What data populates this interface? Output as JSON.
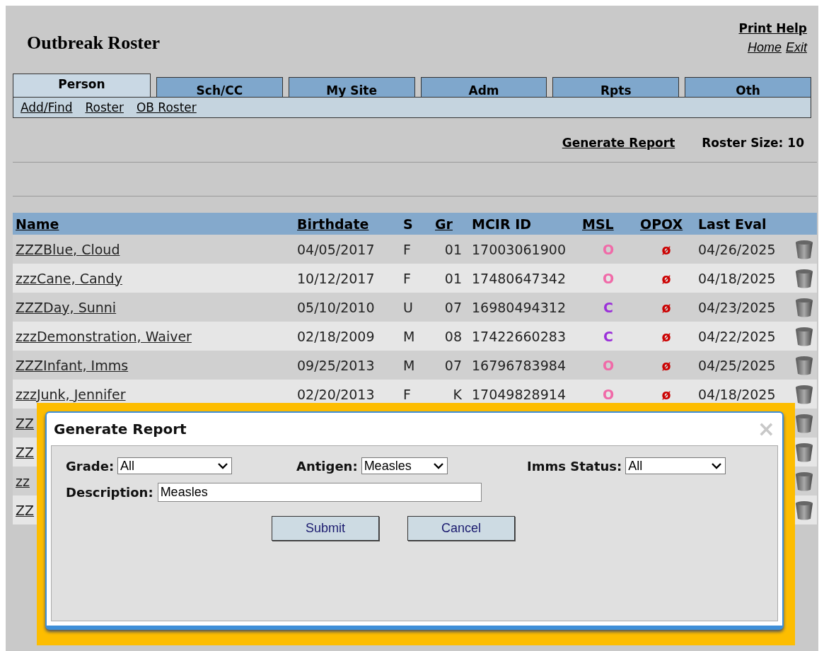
{
  "header": {
    "title": "Outbreak Roster",
    "links": [
      {
        "label": "Print Help",
        "kind": "bold"
      },
      {
        "label": "Home",
        "kind": "italic"
      },
      {
        "label": "Exit",
        "kind": "italic"
      }
    ]
  },
  "tabs": [
    {
      "label": "Person",
      "selected": true
    },
    {
      "label": "Sch/CC",
      "selected": false
    },
    {
      "label": "My Site",
      "selected": false
    },
    {
      "label": "Adm",
      "selected": false
    },
    {
      "label": "Rpts",
      "selected": false
    },
    {
      "label": "Oth",
      "selected": false
    }
  ],
  "subnav": [
    "Add/Find",
    "Roster",
    "OB Roster"
  ],
  "toolbar": {
    "link": "Generate Report",
    "roster_size": "Roster Size: 10"
  },
  "table": {
    "columns": [
      {
        "label": "Name",
        "sortable": true
      },
      {
        "label": "Birthdate",
        "sortable": true
      },
      {
        "label": "S",
        "sortable": false
      },
      {
        "label": "Gr",
        "sortable": true
      },
      {
        "label": "MCIR ID",
        "sortable": false
      },
      {
        "label": "MSL",
        "sortable": true
      },
      {
        "label": "OPOX",
        "sortable": true
      },
      {
        "label": "Last Eval",
        "sortable": false
      }
    ],
    "rows": [
      {
        "name": "ZZZBlue, Cloud",
        "birthdate": "04/05/2017",
        "s": "F",
        "gr": "01",
        "mcir_id": "17003061900",
        "msl": {
          "text": "O",
          "color": "#f06aa8"
        },
        "opox": {
          "text": "ø",
          "color": "#cc0000"
        },
        "last_eval": "04/26/2025"
      },
      {
        "name": "zzzCane, Candy",
        "birthdate": "10/12/2017",
        "s": "F",
        "gr": "01",
        "mcir_id": "17480647342",
        "msl": {
          "text": "O",
          "color": "#f06aa8"
        },
        "opox": {
          "text": "ø",
          "color": "#cc0000"
        },
        "last_eval": "04/18/2025"
      },
      {
        "name": "ZZZDay, Sunni",
        "birthdate": "05/10/2010",
        "s": "U",
        "gr": "07",
        "mcir_id": "16980494312",
        "msl": {
          "text": "C",
          "color": "#9b30d9"
        },
        "opox": {
          "text": "ø",
          "color": "#cc0000"
        },
        "last_eval": "04/23/2025"
      },
      {
        "name": "zzzDemonstration, Waiver",
        "birthdate": "02/18/2009",
        "s": "M",
        "gr": "08",
        "mcir_id": "17422660283",
        "msl": {
          "text": "C",
          "color": "#9b30d9"
        },
        "opox": {
          "text": "ø",
          "color": "#cc0000"
        },
        "last_eval": "04/22/2025"
      },
      {
        "name": "ZZZInfant, Imms",
        "birthdate": "09/25/2013",
        "s": "M",
        "gr": "07",
        "mcir_id": "16796783984",
        "msl": {
          "text": "O",
          "color": "#f06aa8"
        },
        "opox": {
          "text": "ø",
          "color": "#cc0000"
        },
        "last_eval": "04/25/2025"
      },
      {
        "name": "zzzJunk, Jennifer",
        "birthdate": "02/20/2013",
        "s": "F",
        "gr": "K",
        "mcir_id": "17049828914",
        "msl": {
          "text": "O",
          "color": "#f06aa8"
        },
        "opox": {
          "text": "ø",
          "color": "#cc0000"
        },
        "last_eval": "04/18/2025"
      },
      {
        "name": "ZZ"
      },
      {
        "name": "ZZ"
      },
      {
        "name": "zz"
      },
      {
        "name": "ZZ"
      }
    ]
  },
  "dialog": {
    "title": "Generate Report",
    "close": "×",
    "filters": [
      {
        "label": "Grade:",
        "value": "All"
      },
      {
        "label": "Antigen:",
        "value": "Measles"
      },
      {
        "label": "Imms Status:",
        "value": "All"
      }
    ],
    "description": {
      "label": "Description:",
      "value": "Measles"
    },
    "buttons": [
      "Submit",
      "Cancel"
    ]
  }
}
